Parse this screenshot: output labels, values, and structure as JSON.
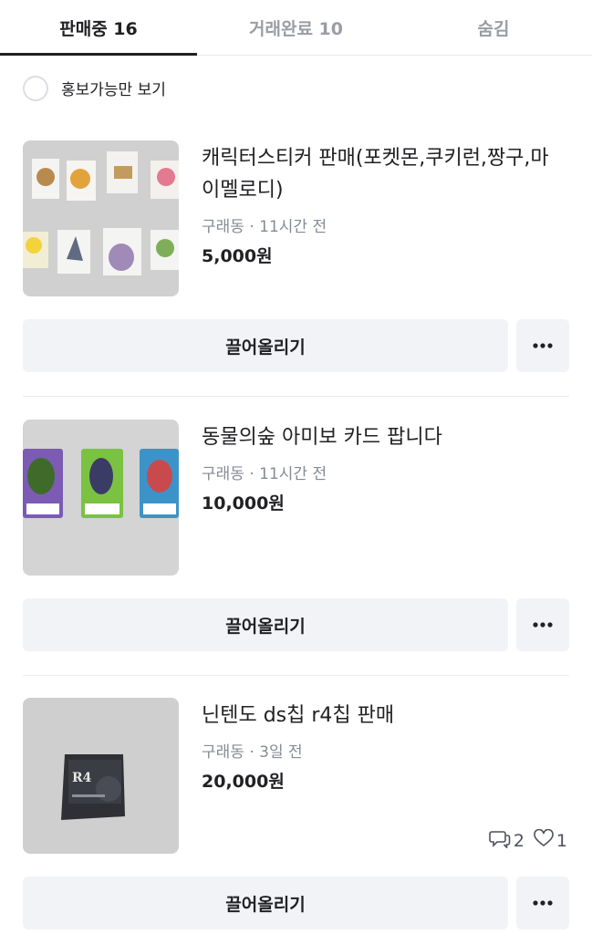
{
  "tabs": [
    {
      "label": "판매중 16",
      "active": true
    },
    {
      "label": "거래완료 10",
      "active": false
    },
    {
      "label": "숨김",
      "active": false
    }
  ],
  "filter": {
    "label": "홍보가능만 보기",
    "checked": false
  },
  "items": [
    {
      "title": "캐릭터스티커 판매(포켓몬,쿠키런,짱구,마이멜로디)",
      "meta": "구래동 · 11시간 전",
      "price": "5,000원",
      "bump_label": "끌어올리기",
      "thumbnail_icon": "sticker-photo"
    },
    {
      "title": "동물의숲 아미보 카드 팝니다",
      "meta": "구래동 · 11시간 전",
      "price": "10,000원",
      "bump_label": "끌어올리기",
      "thumbnail_icon": "amiibo-cards-photo"
    },
    {
      "title": "닌텐도 ds칩 r4칩 판매",
      "meta": "구래동 · 3일 전",
      "price": "20,000원",
      "chat_count": "2",
      "like_count": "1",
      "bump_label": "끌어올리기",
      "thumbnail_icon": "r4-chip-photo",
      "chip_label": "R4"
    }
  ],
  "icons": {
    "more": "more-horizontal-icon",
    "chat": "chat-bubble-icon",
    "like": "heart-icon"
  },
  "colors": {
    "text": "#212124",
    "muted": "#868b94",
    "button_bg": "#f2f3f6",
    "divider": "#eaebee"
  }
}
